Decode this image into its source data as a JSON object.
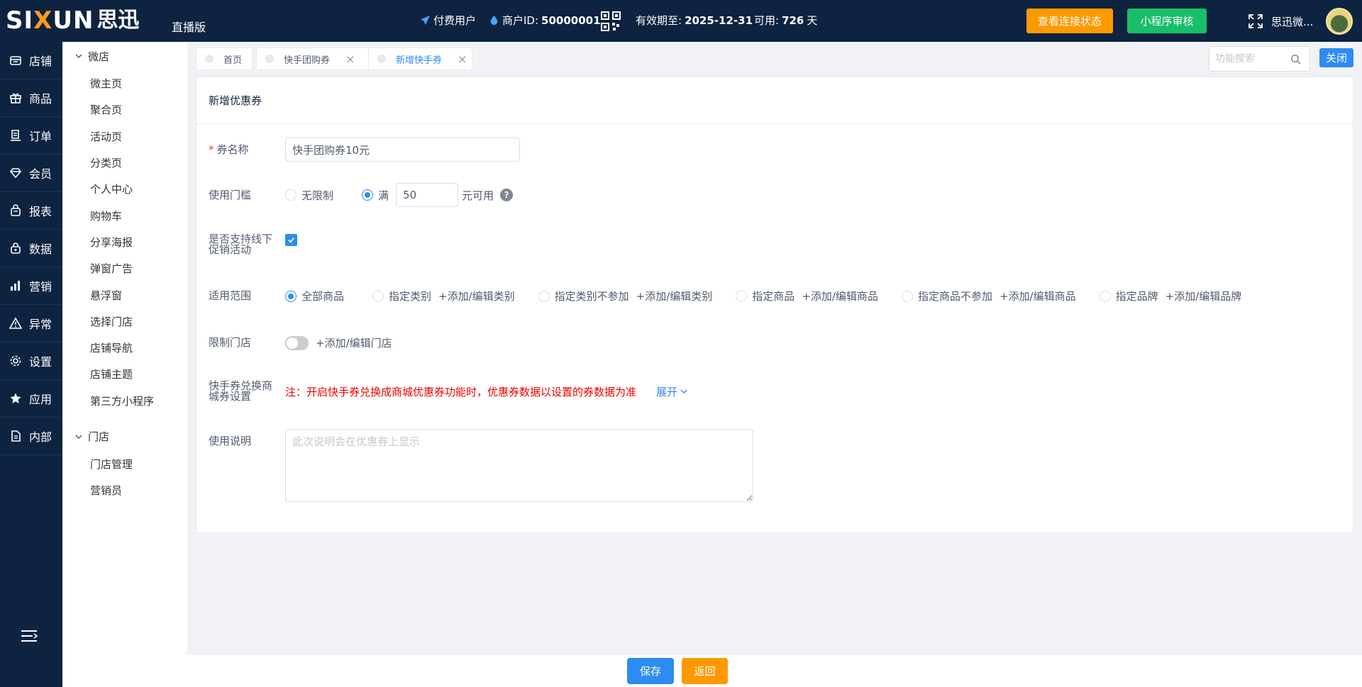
{
  "header": {
    "logo_en_a": "SI",
    "logo_en_x": "X",
    "logo_en_b": "UN",
    "logo_cn": "思迅",
    "edition": "直播版",
    "user_type": "付费用户",
    "merchant_label": "商户ID:",
    "merchant_id": "50000001",
    "expiry_label": "有效期至:",
    "expiry_date": "2025-12-31",
    "available_label": "可用:",
    "available_days": "726",
    "available_unit": "天",
    "check_status_button": "查看连接状态",
    "mini_program_button": "小程序审核",
    "username": "思迅微..."
  },
  "main_nav": [
    {
      "label": "店铺",
      "icon": "store-icon"
    },
    {
      "label": "商品",
      "icon": "gift-icon"
    },
    {
      "label": "订单",
      "icon": "order-icon"
    },
    {
      "label": "会员",
      "icon": "diamond-icon"
    },
    {
      "label": "报表",
      "icon": "bag-icon"
    },
    {
      "label": "数据",
      "icon": "lock-bag-icon"
    },
    {
      "label": "营销",
      "icon": "bar-chart-icon"
    },
    {
      "label": "异常",
      "icon": "warning-icon"
    },
    {
      "label": "设置",
      "icon": "gear-icon"
    },
    {
      "label": "应用",
      "icon": "star-icon"
    },
    {
      "label": "内部",
      "icon": "document-icon"
    }
  ],
  "sub_nav": {
    "group1": "微店",
    "group1_items": [
      "微主页",
      "聚合页",
      "活动页",
      "分类页",
      "个人中心",
      "购物车",
      "分享海报",
      "弹窗广告",
      "悬浮窗",
      "选择门店",
      "店铺导航",
      "店铺主题",
      "第三方小程序"
    ],
    "group2": "门店",
    "group2_items": [
      "门店管理",
      "营销员"
    ]
  },
  "tabs": [
    {
      "label": "首页"
    },
    {
      "label": "快手团购券"
    },
    {
      "label": "新增快手券"
    }
  ],
  "function_search_placeholder": "功能搜索",
  "close_button": "关闭",
  "form": {
    "title": "新增优惠券",
    "required_mark": "*",
    "coupon_name_label": "券名称",
    "coupon_name_value": "快手团购券10元",
    "threshold_label": "使用门槛",
    "threshold_none": "无限制",
    "threshold_full": "满",
    "threshold_amount": "50",
    "threshold_suffix": "元可用",
    "help_glyph": "?",
    "offline_label_1": "是否支持线下",
    "offline_label_2": "促销活动",
    "offline_checked": true,
    "scope_label": "适用范围",
    "scope_options": [
      {
        "label": "全部商品",
        "selected": true,
        "link": ""
      },
      {
        "label": "指定类别",
        "selected": false,
        "link": "+添加/编辑类别"
      },
      {
        "label": "指定类别不参加",
        "selected": false,
        "link": "+添加/编辑类别"
      },
      {
        "label": "指定商品",
        "selected": false,
        "link": "+添加/编辑商品"
      },
      {
        "label": "指定商品不参加",
        "selected": false,
        "link": "+添加/编辑商品"
      },
      {
        "label": "指定品牌",
        "selected": false,
        "link": "+添加/编辑品牌"
      }
    ],
    "store_limit_label": "限制门店",
    "store_limit_link": "+添加/编辑门店",
    "store_limit_on": false,
    "exchange_label_1": "快手券兑换商",
    "exchange_label_2": "城券设置",
    "exchange_note": "注：开启快手券兑换成商城优惠券功能时，优惠券数据以设置的券数据为准",
    "expand_label": "展开",
    "usage_label": "使用说明",
    "usage_placeholder": "此次说明会在优惠券上显示"
  },
  "footer": {
    "save_button": "保存",
    "back_button": "返回"
  },
  "colors": {
    "nav_bg": "#0d2340",
    "primary": "#2d8cf0",
    "orange": "#ff9900",
    "green": "#19be6b",
    "warning_red": "#ed0000"
  }
}
